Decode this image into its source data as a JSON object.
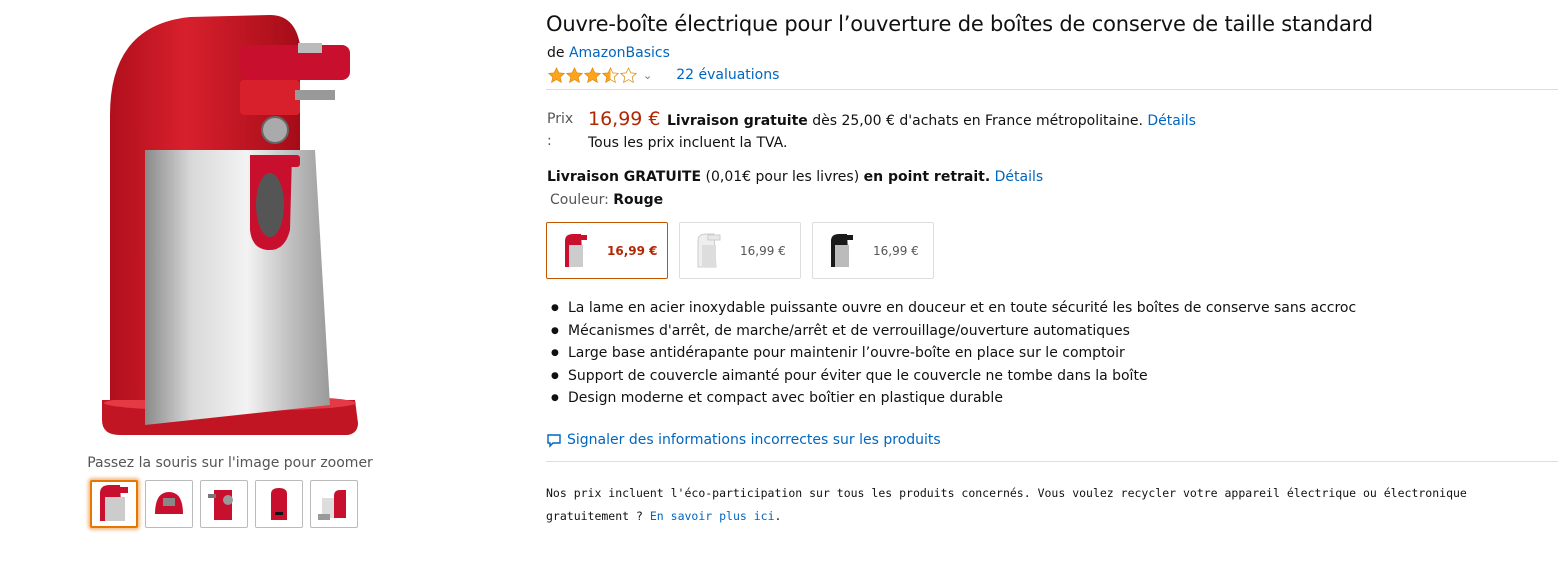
{
  "product": {
    "title": "Ouvre-boîte électrique pour l’ouverture de boîtes de conserve de taille standard",
    "byline_prefix": "de",
    "brand": "AmazonBasics",
    "rating": 3.5,
    "rating_count_text": "22 évaluations"
  },
  "price": {
    "label": "Prix :",
    "value": "16,99 €",
    "free_shipping_bold": "Livraison gratuite",
    "shipping_text": "dès 25,00 € d'achats en France métropolitaine.",
    "details_link": "Détails",
    "vat_text": "Tous les prix incluent la TVA."
  },
  "pickup": {
    "bold1": "Livraison GRATUITE",
    "mid": "(0,01€ pour les livres)",
    "bold2": "en point retrait.",
    "details_link": "Détails"
  },
  "color": {
    "label": "Couleur:",
    "selected": "Rouge",
    "options": [
      {
        "name": "red",
        "price": "16,99 €",
        "selected": true,
        "color": "#c8102e"
      },
      {
        "name": "white",
        "price": "16,99 €",
        "selected": false,
        "color": "#e8e8e8"
      },
      {
        "name": "black",
        "price": "16,99 €",
        "selected": false,
        "color": "#1a1a1a"
      }
    ]
  },
  "bullets": [
    "La lame en acier inoxydable puissante ouvre en douceur et en toute sécurité les boîtes de conserve sans accroc",
    "Mécanismes d'arrêt, de marche/arrêt et de verrouillage/ouverture automatiques",
    "Large base antidérapante pour maintenir l’ouvre-boîte en place sur le comptoir",
    "Support de couvercle aimanté pour éviter que le couvercle ne tombe dans la boîte",
    "Design moderne et compact avec boîtier en plastique durable"
  ],
  "report_link": "Signaler des informations incorrectes sur les produits",
  "eco": {
    "text": "Nos prix incluent l'éco-participation sur tous les produits concernés. Vous voulez recycler votre appareil électrique ou électronique gratuitement ?",
    "link": "En savoir plus ici",
    "suffix": "."
  },
  "gallery": {
    "zoom_hint": "Passez la souris sur l'image pour zoomer",
    "thumbnails": [
      "front",
      "top",
      "side",
      "back",
      "detail"
    ]
  },
  "colors": {
    "price_red": "#b12704",
    "link_blue": "#0066c0",
    "star_orange": "#ffa41c",
    "selected_border": "#e77600"
  }
}
